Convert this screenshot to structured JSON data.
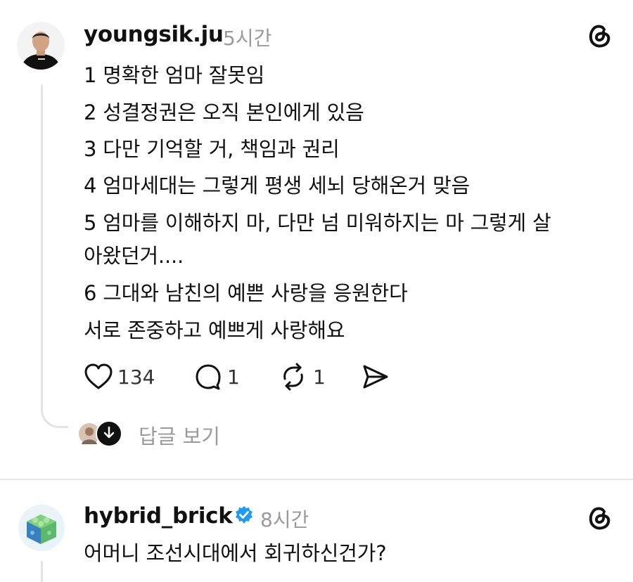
{
  "post1": {
    "username": "youngsik.ju",
    "time": "5시간",
    "lines": [
      "1 명확한 엄마 잘못임",
      "2 성결정권은 오직 본인에게 있음",
      "3 다만 기억할 거, 책임과 권리",
      "4 엄마세대는 그렇게 평생 세뇌 당해온거 맞음",
      "5 엄마를 이해하지 마, 다만 넘 미워하지는 마 그렇게 살",
      "아왔던거....",
      "6 그대와 남친의 예쁜 사랑을 응원한다",
      "서로 존중하고 예쁘게 사랑해요"
    ],
    "likes": "134",
    "comments": "1",
    "reposts": "1",
    "reply_link": "답글 보기"
  },
  "post2": {
    "username": "hybrid_brick",
    "time": "8시간",
    "verified": true,
    "lines": [
      "어머니 조선시대에서 회귀하신건가?"
    ]
  },
  "icons": {
    "threads": "threads-logo-icon",
    "like": "heart-icon",
    "comment": "comment-bubble-icon",
    "repost": "repost-icon",
    "share": "send-icon",
    "verified": "verified-badge-icon",
    "expand": "arrow-down-icon"
  },
  "colors": {
    "verified": "#1d9bf0",
    "muted": "#9a9a9a"
  }
}
